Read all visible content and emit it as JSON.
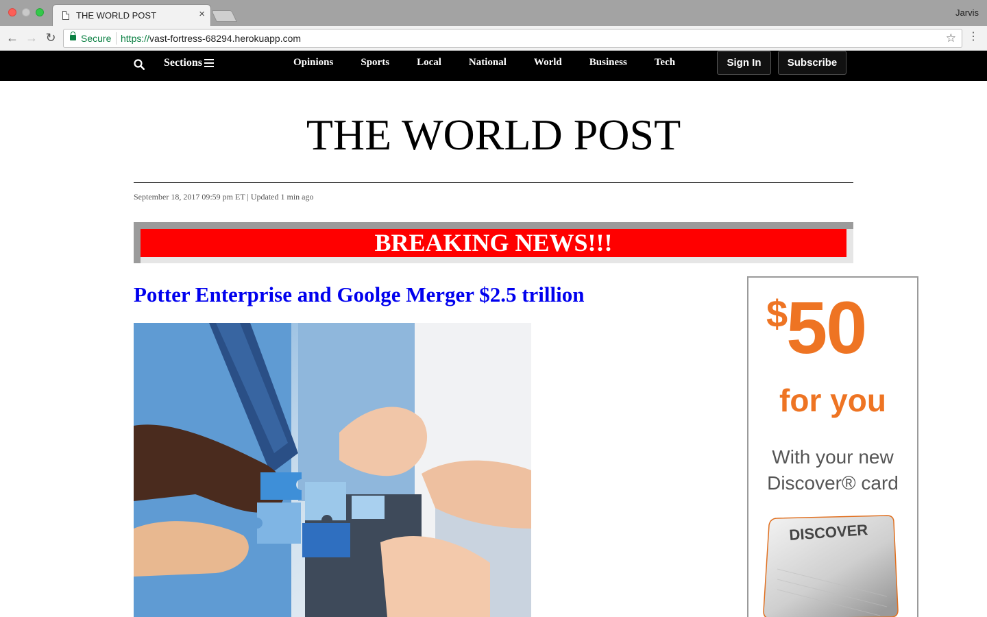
{
  "browser": {
    "tab_title": "THE WORLD POST",
    "tab_close": "×",
    "profile": "Jarvis",
    "secure_label": "Secure",
    "url_scheme": "https://",
    "url_host": "vast-fortress-68294.herokuapp.com",
    "back_icon": "arrow-left-icon",
    "forward_icon": "arrow-right-icon",
    "reload_icon": "reload-icon",
    "bookmark_icon": "star-icon",
    "menu_icon": "kebab-menu-icon"
  },
  "nav": {
    "sections_label": "Sections",
    "links": [
      "Opinions",
      "Sports",
      "Local",
      "National",
      "World",
      "Business",
      "Tech"
    ],
    "sign_in": "Sign In",
    "subscribe": "Subscribe"
  },
  "masthead": {
    "title": "THE WORLD POST",
    "dateline": "September 18, 2017 09:59 pm ET | Updated 1 min ago"
  },
  "banner": {
    "text": "BREAKING NEWS!!!",
    "color": "#ff0000"
  },
  "article": {
    "headline": "Potter Enterprise and Goolge Merger $2.5 trillion",
    "headline_color": "#0000ee"
  },
  "ad": {
    "amount_sign": "$",
    "amount": "50",
    "line_for_you": "for you",
    "line1": "With your new",
    "line2": "Discover® card",
    "card_brand": "DISCOVER",
    "accent": "#ee7423"
  }
}
